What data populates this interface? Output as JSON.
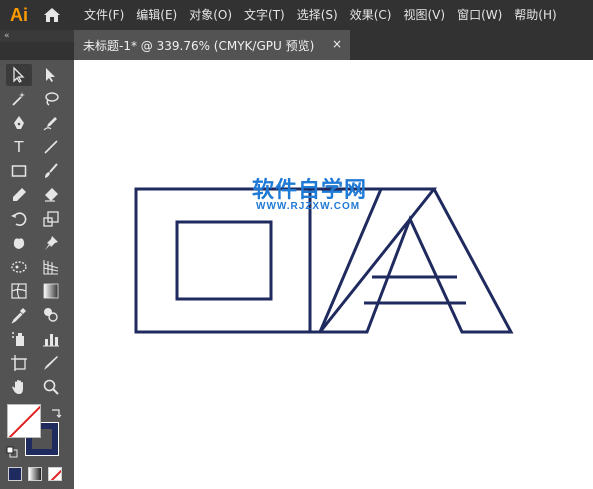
{
  "app": {
    "logo": "Ai"
  },
  "menu": {
    "items": [
      "文件(F)",
      "编辑(E)",
      "对象(O)",
      "文字(T)",
      "选择(S)",
      "效果(C)",
      "视图(V)",
      "窗口(W)",
      "帮助(H)"
    ]
  },
  "panel": {
    "collapse": "«"
  },
  "document_tab": {
    "title": "未标题-1* @ 339.76% (CMYK/GPU 预览)",
    "close": "×"
  },
  "canvas": {
    "stroke_color": "#1f2a5e",
    "watermark": {
      "title": "软件自学网",
      "url": "WWW.RJZXW.COM",
      "color": "#1f7ad6"
    }
  },
  "colors": {
    "fill": "#ffffff",
    "stroke": "#1f2a5e",
    "none_slash": "#e02020"
  }
}
